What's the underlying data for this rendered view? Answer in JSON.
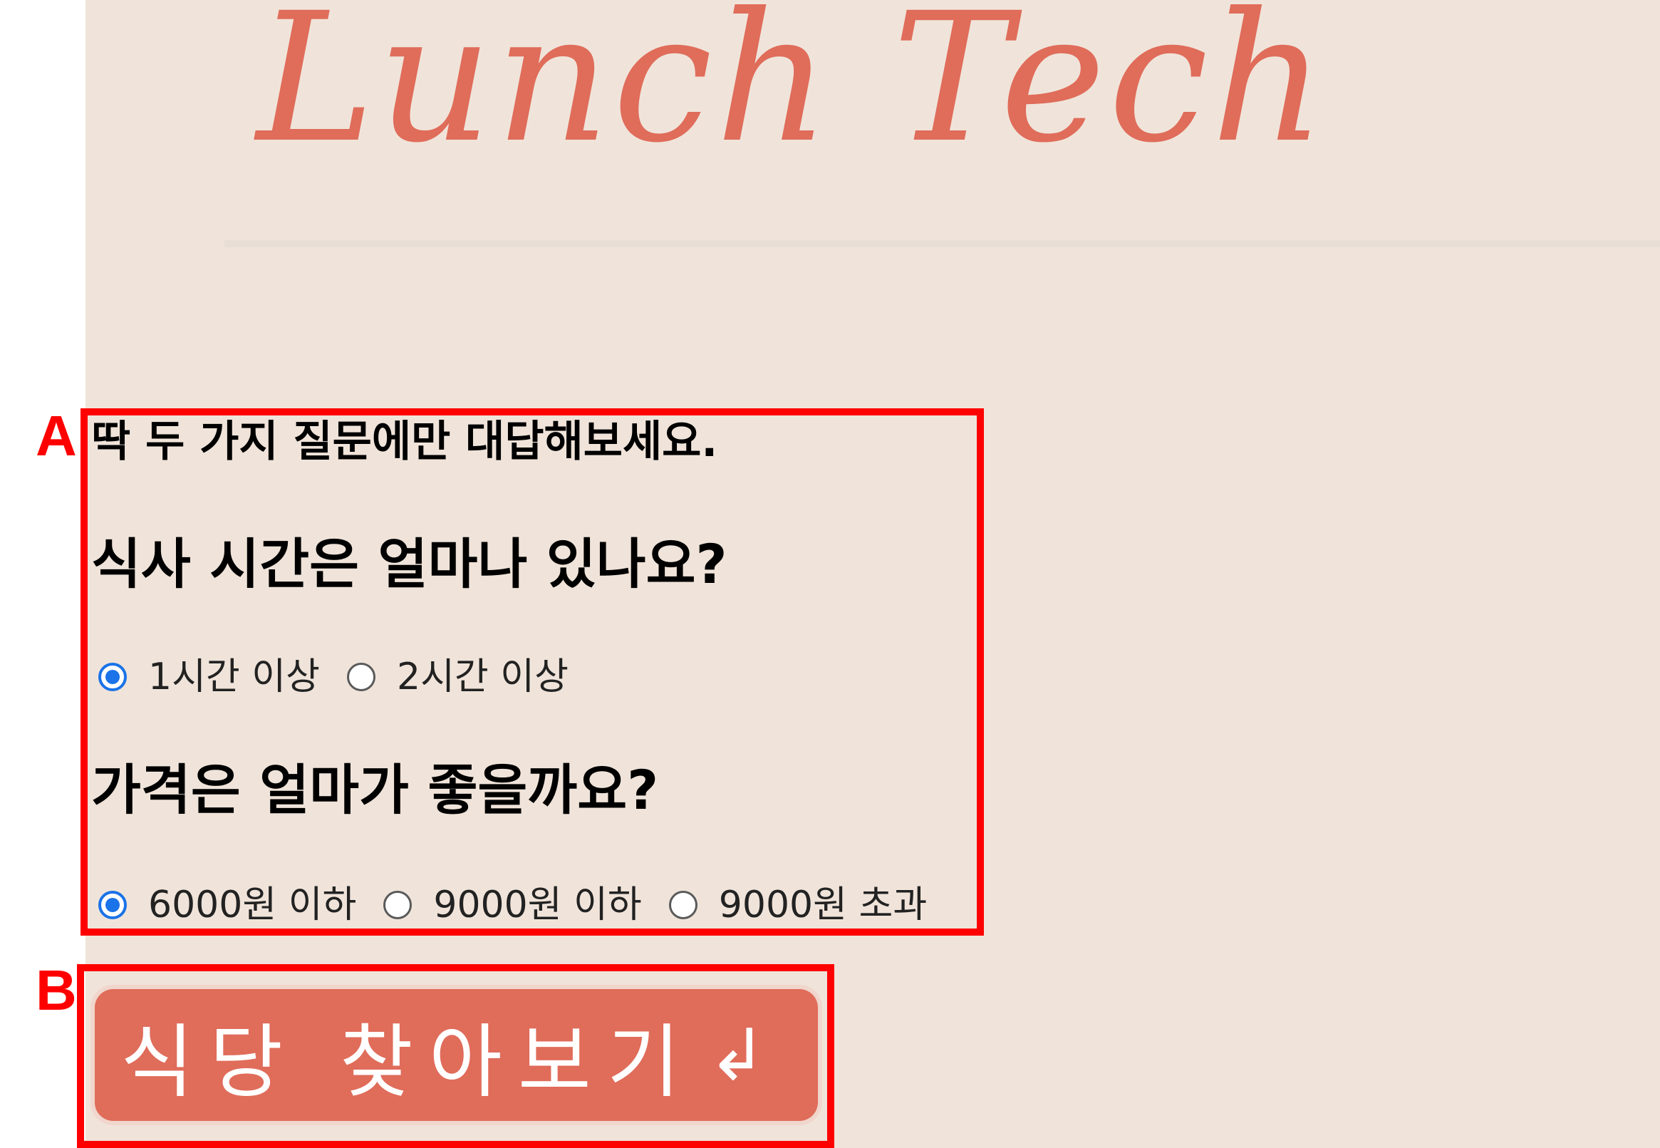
{
  "header": {
    "title": "Lunch Tech"
  },
  "markers": {
    "a": "A",
    "b": "B"
  },
  "form": {
    "intro": "딱 두 가지 질문에만 대답해보세요.",
    "q1": {
      "label": "식사 시간은 얼마나 있나요?",
      "options": [
        {
          "label": "1시간 이상",
          "checked": true
        },
        {
          "label": "2시간 이상",
          "checked": false
        }
      ]
    },
    "q2": {
      "label": "가격은 얼마가 좋을까요?",
      "options": [
        {
          "label": "6000원 이하",
          "checked": true
        },
        {
          "label": "9000원 이하",
          "checked": false
        },
        {
          "label": "9000원 초과",
          "checked": false
        }
      ]
    }
  },
  "button": {
    "label": "식당 찾아보기",
    "icon": "enter-icon",
    "icon_glyph": "↲"
  },
  "colors": {
    "accent": "#e06c5a",
    "background": "#f0e4da",
    "radio_checked": "#1a73e8",
    "annotation": "#ff0000"
  }
}
